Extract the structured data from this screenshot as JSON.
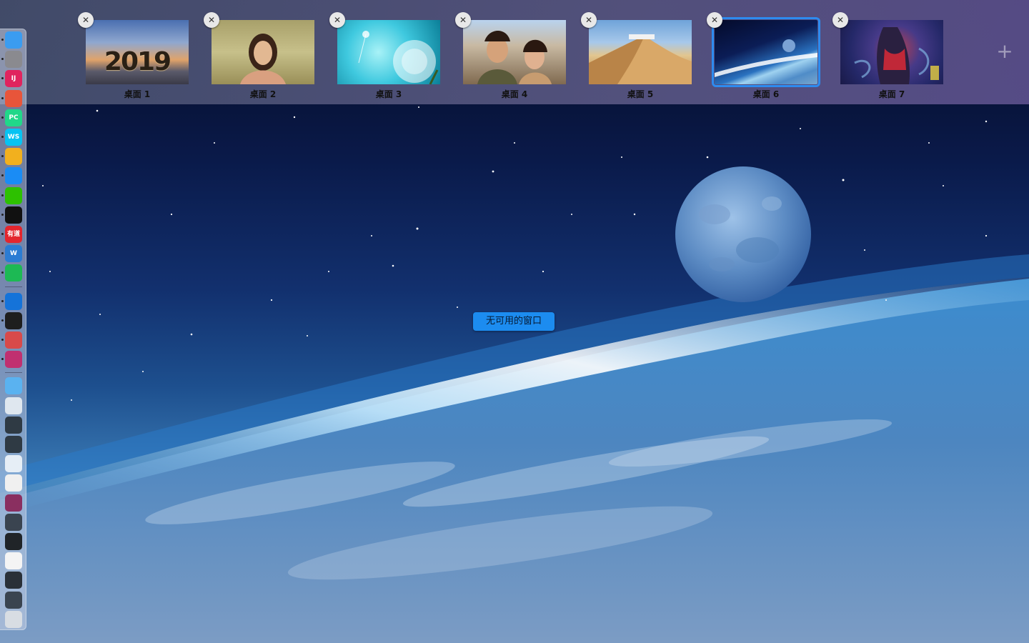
{
  "spaces": [
    {
      "label": "桌面 1",
      "thumb_text": "2019",
      "active": false
    },
    {
      "label": "桌面 2",
      "active": false
    },
    {
      "label": "桌面 3",
      "active": false
    },
    {
      "label": "桌面 4",
      "active": false
    },
    {
      "label": "桌面 5",
      "active": false
    },
    {
      "label": "桌面 6",
      "active": true
    },
    {
      "label": "桌面 7",
      "active": false
    }
  ],
  "close_glyph": "✕",
  "add_space_glyph": "+",
  "center_message": "无可用的窗口",
  "dock": {
    "items": [
      {
        "name": "finder-icon",
        "text": "",
        "color": "#3b9cf0"
      },
      {
        "name": "system-preferences-icon",
        "text": "",
        "color": "#8a8a8f"
      },
      {
        "name": "intellij-idea-icon",
        "text": "IJ",
        "color": "#e0245e"
      },
      {
        "name": "chromium-icon",
        "text": "",
        "color": "#e8553a"
      },
      {
        "name": "pycharm-icon",
        "text": "PC",
        "color": "#21d789"
      },
      {
        "name": "webstorm-icon",
        "text": "WS",
        "color": "#07c3f2"
      },
      {
        "name": "chrome-icon",
        "text": "",
        "color": "#f2b01e"
      },
      {
        "name": "safari-icon",
        "text": "",
        "color": "#1a8cf5"
      },
      {
        "name": "wechat-icon",
        "text": "",
        "color": "#2dc100"
      },
      {
        "name": "qq-icon",
        "text": "",
        "color": "#111111"
      },
      {
        "name": "youdao-icon",
        "text": "有道",
        "color": "#e3262e"
      },
      {
        "name": "word-icon",
        "text": "W",
        "color": "#2b7cd3"
      },
      {
        "name": "music-icon",
        "text": "",
        "color": "#1db954"
      },
      {
        "name": "xcode-icon",
        "text": "",
        "color": "#1573d9"
      },
      {
        "name": "terminal-icon",
        "text": "",
        "color": "#1e1e1e"
      },
      {
        "name": "app-window-icon",
        "text": "",
        "color": "#d84a4a"
      },
      {
        "name": "app-window-icon",
        "text": "",
        "color": "#c03070"
      },
      {
        "name": "applications-folder-icon",
        "text": "",
        "color": "#5ab2f0"
      },
      {
        "name": "preview-icon",
        "text": "",
        "color": "#dfe7ef"
      },
      {
        "name": "minimized-window-icon",
        "text": "",
        "color": "#2f3a44"
      },
      {
        "name": "minimized-window-icon",
        "text": "",
        "color": "#2f3a44"
      },
      {
        "name": "minimized-window-icon",
        "text": "",
        "color": "#e6eef6"
      },
      {
        "name": "minimized-window-icon",
        "text": "",
        "color": "#f0f0f0"
      },
      {
        "name": "minimized-window-icon",
        "text": "",
        "color": "#8a2f60"
      },
      {
        "name": "minimized-window-icon",
        "text": "",
        "color": "#3a4450"
      },
      {
        "name": "minimized-window-icon",
        "text": "",
        "color": "#202428"
      },
      {
        "name": "minimized-window-icon",
        "text": "",
        "color": "#f4f4f4"
      },
      {
        "name": "minimized-window-icon",
        "text": "",
        "color": "#2a3038"
      },
      {
        "name": "minimized-window-icon",
        "text": "",
        "color": "#3a4450"
      },
      {
        "name": "trash-icon",
        "text": "",
        "color": "#d8dde3"
      }
    ]
  }
}
